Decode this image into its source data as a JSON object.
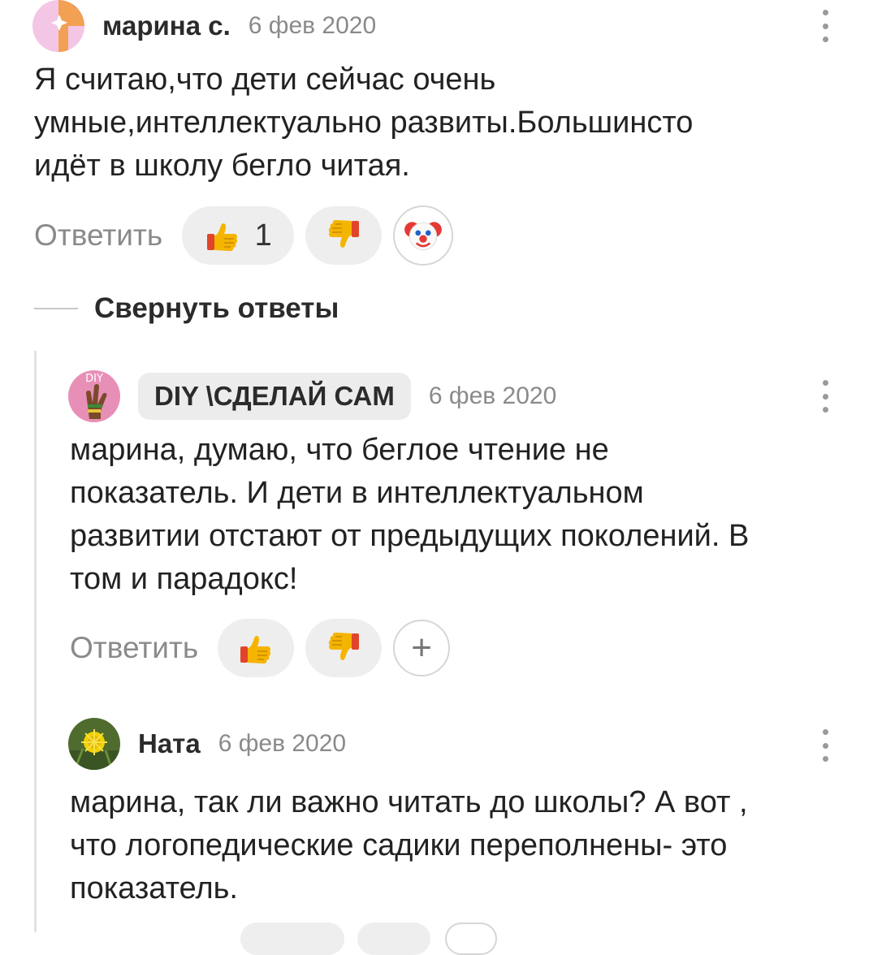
{
  "comments": [
    {
      "author": "марина с.",
      "date": "6 фев 2020",
      "text": "Я считаю,что дети сейчас очень\nумные,интеллектуально развиты.Большинсто\nидёт в школу бегло читая.",
      "reply_label": "Ответить",
      "like_count": "1",
      "reaction_icon": "clown-face-icon"
    },
    {
      "author": "DIY \\СДЕЛАЙ САМ",
      "avatar_text": "DIY",
      "date": "6 фев 2020",
      "text": "марина, думаю, что беглое чтение не\nпоказатель. И дети в интеллектуальном\nразвитии отстают от предыдущих поколений. В\nтом и парадокс!",
      "reply_label": "Ответить",
      "add_reaction": "+"
    },
    {
      "author": "Ната",
      "date": "6 фев 2020",
      "text": "марина, так ли важно читать до школы? А вот ,\nчто логопедические садики переполнены- это\nпоказатель."
    }
  ],
  "collapse_label": "Свернуть ответы",
  "colors": {
    "accent_text": "#222222",
    "muted": "#8a8a8a",
    "pill_bg": "#eeeeee",
    "thread_line": "#e2e2e2"
  },
  "icons": {
    "like": "thumbs-up-icon",
    "dislike": "thumbs-down-icon",
    "menu": "more-vertical-icon"
  }
}
